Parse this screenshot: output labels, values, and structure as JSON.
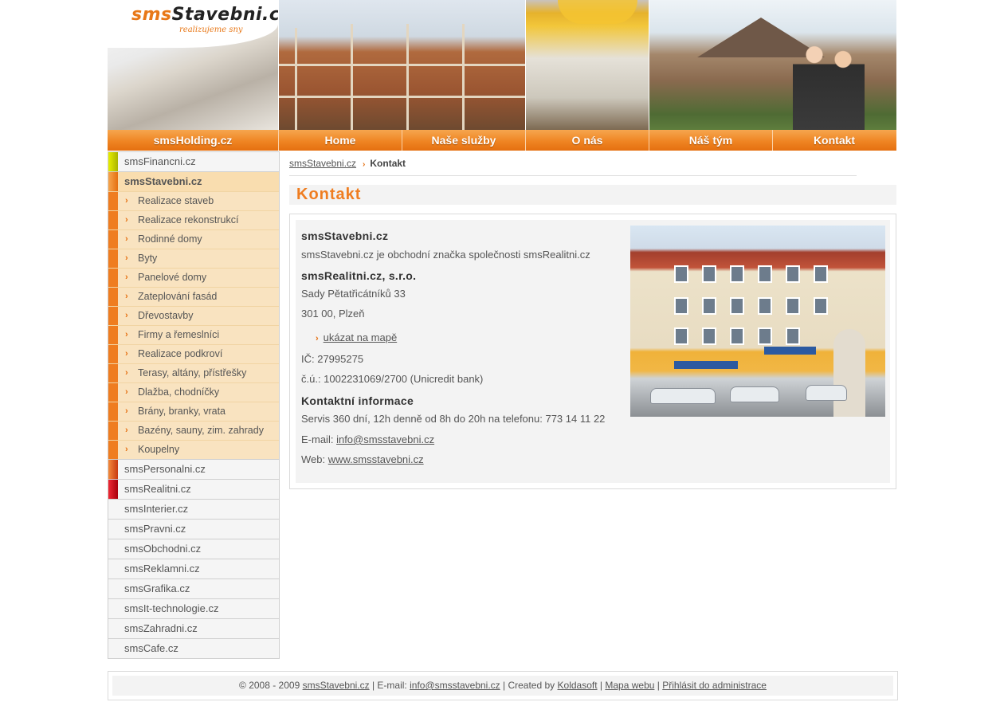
{
  "header": {
    "logo_part1": "sms",
    "logo_part2": "Stavebni.cz",
    "tagline": "realizujeme sny"
  },
  "nav": [
    "smsHolding.cz",
    "Home",
    "Naše služby",
    "O nás",
    "Náš tým",
    "Kontakt"
  ],
  "sidebar": {
    "top_items": [
      {
        "label": "smsFinancni.cz",
        "color": "#c9d600"
      }
    ],
    "active_item": {
      "label": "smsStavebni.cz",
      "color": "#ef7d20"
    },
    "sub_items": [
      "Realizace staveb",
      "Realizace rekonstrukcí",
      "Rodinné domy",
      "Byty",
      "Panelové domy",
      "Zateplování fasád",
      "Dřevostavby",
      "Firmy a řemeslníci",
      "Realizace podkroví",
      "Terasy, altány, přístřešky",
      "Dlažba, chodníčky",
      "Brány, branky, vrata",
      "Bazény, sauny, zim. zahrady",
      "Koupelny"
    ],
    "bottom_items": [
      {
        "label": "smsPersonalni.cz",
        "color": "#e0501c"
      },
      {
        "label": "smsRealitni.cz",
        "color": "#d2101e"
      },
      {
        "label": "smsInterier.cz",
        "color": ""
      },
      {
        "label": "smsPravni.cz",
        "color": ""
      },
      {
        "label": "smsObchodni.cz",
        "color": ""
      },
      {
        "label": "smsReklamni.cz",
        "color": ""
      },
      {
        "label": "smsGrafika.cz",
        "color": ""
      },
      {
        "label": "smsIt-technologie.cz",
        "color": ""
      },
      {
        "label": "smsZahradni.cz",
        "color": ""
      },
      {
        "label": "smsCafe.cz",
        "color": ""
      }
    ]
  },
  "breadcrumb": {
    "home": "smsStavebni.cz",
    "current": "Kontakt"
  },
  "page_title": "Kontakt",
  "contact": {
    "company_heading": "smsStavebni.cz",
    "company_desc": "smsStavebni.cz je obchodní značka společnosti smsRealitni.cz",
    "owner_heading": "smsRealitni.cz, s.r.o.",
    "street": "Sady Pětatřicátníků 33",
    "city": "301 00, Plzeň",
    "map_link": "ukázat na mapě",
    "ic": "IČ: 27995275",
    "account": "č.ú.: 1002231069/2700 (Unicredit bank)",
    "info_heading": "Kontaktní informace",
    "service": "Servis 360 dní, 12h denně od 8h do 20h na telefonu: 773 14 11 22",
    "email_label": "E-mail:",
    "email": "info@smsstavebni.cz",
    "web_label": "Web:",
    "web": "www.smsstavebni.cz"
  },
  "footer": {
    "copyright": "© 2008 - 2009",
    "site": "smsStavebni.cz",
    "email_label": "| E-mail:",
    "email": "info@smsstavebni.cz",
    "created_label": "| Created by",
    "creator": "Koldasoft",
    "sep1": "|",
    "sitemap": "Mapa webu",
    "sep2": "|",
    "admin": "Přihlásit do administrace"
  },
  "colors": {
    "accent": "#ef7d20",
    "nav_orange": "#ef8523",
    "sub_bg": "#f9e3c0"
  }
}
